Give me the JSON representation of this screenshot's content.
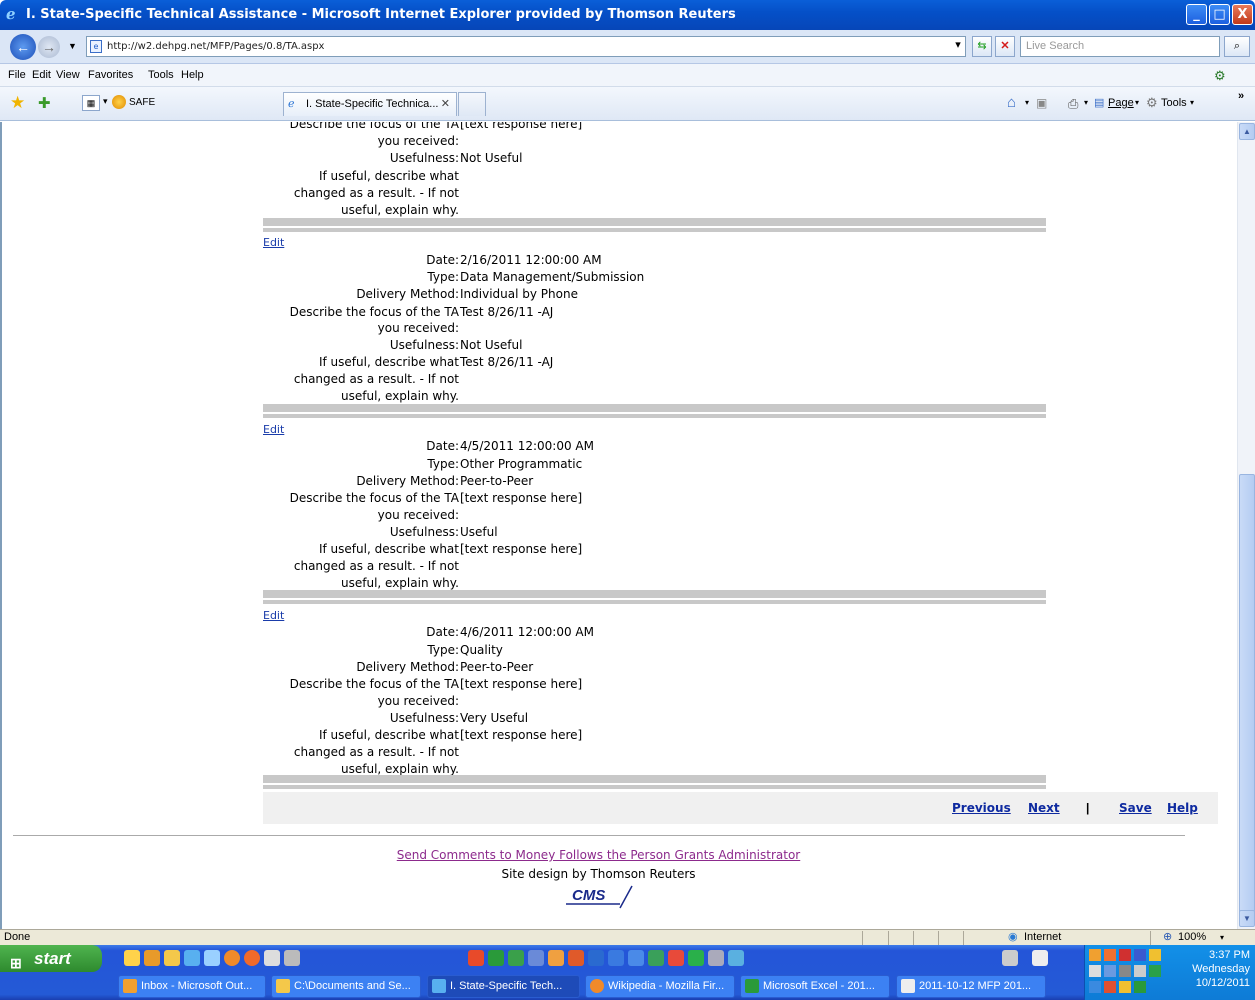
{
  "window": {
    "title": "I. State-Specific Technical Assistance - Microsoft Internet Explorer provided by Thomson Reuters",
    "min_glyph": "_",
    "max_glyph": "□",
    "close_glyph": "X"
  },
  "address": {
    "url": "http://w2.dehpg.net/MFP/Pages/0.8/TA.aspx",
    "search_placeholder": "Live Search"
  },
  "menu": [
    "File",
    "Edit",
    "View",
    "Favorites",
    "Tools",
    "Help"
  ],
  "favorites": {
    "safe_label": "SAFE",
    "tab_label": "I. State-Specific Technica...",
    "page_label": "Page",
    "tools_label": "Tools"
  },
  "top_partial": {
    "focus_label": "Describe the focus of the TA",
    "focus_cont": "you received:",
    "focus_value": "[text response here]",
    "usefulness_label": "Usefulness:",
    "usefulness_value": "Not Useful",
    "result_label_1": "If useful, describe what",
    "result_label_2": "changed as a result. - If not",
    "result_label_3": "useful, explain why."
  },
  "labels": {
    "edit": "Edit",
    "date": "Date:",
    "type": "Type:",
    "delivery": "Delivery Method:",
    "focus_1": "Describe the focus of the TA",
    "focus_2": "you received:",
    "usefulness": "Usefulness:",
    "result_1": "If useful, describe what",
    "result_2": "changed as a result. - If not",
    "result_3": "useful, explain why."
  },
  "records": [
    {
      "date": "2/16/2011 12:00:00 AM",
      "type": "Data Management/Submission",
      "delivery": "Individual by Phone",
      "focus": "Test 8/26/11 -AJ",
      "usefulness": "Not Useful",
      "result": "Test 8/26/11 -AJ"
    },
    {
      "date": "4/5/2011 12:00:00 AM",
      "type": "Other Programmatic",
      "delivery": "Peer-to-Peer",
      "focus": "[text response here]",
      "usefulness": "Useful",
      "result": "[text response here]"
    },
    {
      "date": "4/6/2011 12:00:00 AM",
      "type": "Quality",
      "delivery": "Peer-to-Peer",
      "focus": "[text response here]",
      "usefulness": "Very Useful",
      "result": "[text response here]"
    }
  ],
  "nav": {
    "previous": "Previous",
    "next": "Next",
    "pipe": "|",
    "save": "Save",
    "help": "Help"
  },
  "footer": {
    "comments_link": "Send Comments to Money Follows the Person Grants Administrator",
    "design_credit": "Site design by Thomson Reuters",
    "logo_text": "CMS"
  },
  "status": {
    "left": "Done",
    "zone": "Internet",
    "zoom": "100%"
  },
  "taskbar": {
    "start": "start",
    "tasks": [
      "Inbox - Microsoft Out...",
      "C:\\Documents and Se...",
      "I. State-Specific Tech...",
      "Wikipedia - Mozilla Fir...",
      "Microsoft Excel - 201...",
      "2011-10-12 MFP 201..."
    ],
    "time": "3:37 PM",
    "day": "Wednesday",
    "date": "10/12/2011"
  }
}
